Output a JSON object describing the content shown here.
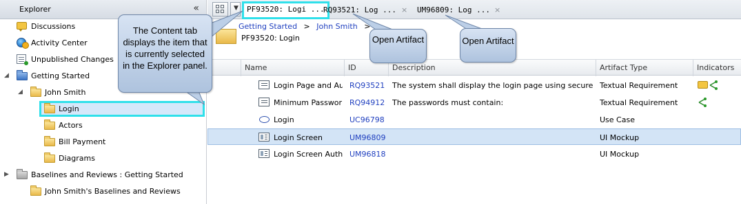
{
  "explorer": {
    "title": "Explorer",
    "collapse_glyph": "«",
    "items": [
      {
        "label": "Discussions",
        "icon": "discussion-icon"
      },
      {
        "label": "Activity Center",
        "icon": "activity-center-icon"
      },
      {
        "label": "Unpublished Changes",
        "icon": "unpublished-changes-icon"
      },
      {
        "label": "Getting Started",
        "icon": "project-folder-icon",
        "expanded": true
      },
      {
        "label": "John Smith",
        "icon": "folder-icon",
        "expanded": true
      },
      {
        "label": "Login",
        "icon": "folder-icon",
        "selected": true
      },
      {
        "label": "Actors",
        "icon": "folder-icon"
      },
      {
        "label": "Bill Payment",
        "icon": "folder-icon"
      },
      {
        "label": "Diagrams",
        "icon": "folder-icon"
      },
      {
        "label": "Baselines and Reviews : Getting Started",
        "icon": "baseline-folder-icon",
        "expanded": false
      },
      {
        "label": "John Smith's Baselines and Reviews",
        "icon": "folder-icon"
      }
    ]
  },
  "tabs": [
    {
      "label": "PF93520: Logi ...",
      "active": true
    },
    {
      "label": "RQ93521: Log ...",
      "close": "×"
    },
    {
      "label": "UM96809: Log ...",
      "close": "×"
    }
  ],
  "content": {
    "breadcrumb": [
      "Getting Started",
      "John Smith"
    ],
    "breadcrumb_sep": ">",
    "subtitle": "PF93520: Login"
  },
  "table": {
    "columns": [
      "Name",
      "ID",
      "Description",
      "Artifact Type",
      "Indicators"
    ],
    "rows": [
      {
        "name": "Login Page and Au",
        "id": "RQ93521",
        "description": "The system shall display the login page using secure",
        "type": "Textual Requirement",
        "icon": "requirement-icon",
        "indicators": [
          "comment-icon",
          "trace-link-icon"
        ]
      },
      {
        "name": "Minimum Passwor",
        "id": "RQ94912",
        "description": "The passwords must contain:",
        "type": "Textual Requirement",
        "icon": "requirement-icon",
        "indicators": [
          "trace-link-icon"
        ]
      },
      {
        "name": "Login",
        "id": "UC96798",
        "description": "",
        "type": "Use Case",
        "icon": "use-case-icon",
        "indicators": []
      },
      {
        "name": "Login Screen",
        "id": "UM96809",
        "description": "",
        "type": "UI Mockup",
        "icon": "ui-mockup-icon",
        "indicators": [],
        "selected": true
      },
      {
        "name": "Login Screen Auth",
        "id": "UM96818",
        "description": "",
        "type": "UI Mockup",
        "icon": "ui-mockup-icon",
        "indicators": []
      }
    ]
  },
  "callouts": {
    "main": "The Content tab displays the item that is currently selected in the Explorer panel.",
    "open1": "Open Artifact",
    "open2": "Open Artifact"
  },
  "colors": {
    "highlight": "#2fe0ea",
    "link": "#1f3fbf",
    "selection": "#d3e4f6",
    "callout": "#c3d4ea"
  }
}
